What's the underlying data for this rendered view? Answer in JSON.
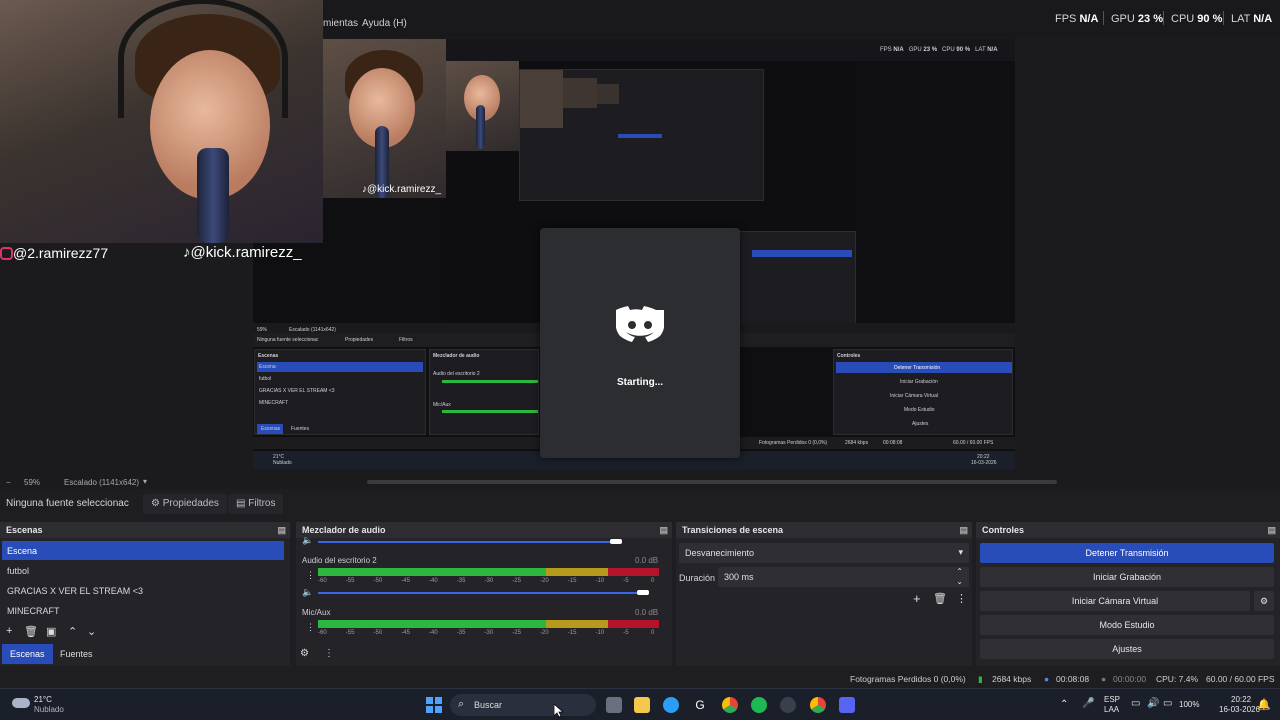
{
  "menu": {
    "items": [
      "mientas",
      "Ayuda (H)"
    ]
  },
  "stats": {
    "fps_label": "FPS",
    "fps_value": "N/A",
    "gpu_label": "GPU",
    "gpu_value": "23 %",
    "cpu_label": "CPU",
    "cpu_value": "90 %",
    "lat_label": "LAT",
    "lat_value": "N/A"
  },
  "overlay": {
    "instagram": "@2.ramirezz77",
    "tiktok": "@kick.ramirezz_",
    "tiktok_inner": "@kick.ramirezz_"
  },
  "discord": {
    "status": "Starting..."
  },
  "preview_footer": {
    "zoom": "59%",
    "scale": "Escalado (1141x642)"
  },
  "source_toolbar": {
    "no_source": "Ninguna fuente seleccionac",
    "properties": "Propiedades",
    "filters": "Filtros"
  },
  "scenes": {
    "title": "Escenas",
    "items": [
      "Escena",
      "futbol",
      "GRACIAS X VER EL STREAM <3",
      "MINECRAFT"
    ],
    "tabs": [
      "Escenas",
      "Fuentes"
    ]
  },
  "mixer": {
    "title": "Mezclador de audio",
    "channels": [
      {
        "name": "Audio del escritorio 2",
        "db": "0.0 dB",
        "level": 0.97
      },
      {
        "name": "Mic/Aux",
        "db": "0.0 dB",
        "level": 1.0
      }
    ],
    "ticks": [
      "-60",
      "-55",
      "-50",
      "-45",
      "-40",
      "-35",
      "-30",
      "-25",
      "-20",
      "-15",
      "-10",
      "-5",
      "0"
    ]
  },
  "transitions": {
    "title": "Transiciones de escena",
    "selected": "Desvanecimiento",
    "duration_label": "Duración",
    "duration_value": "300 ms"
  },
  "controls": {
    "title": "Controles",
    "stop_stream": "Detener Transmisión",
    "start_recording": "Iniciar Grabación",
    "start_virtual_cam": "Iniciar Cámara Virtual",
    "studio_mode": "Modo Estudio",
    "settings": "Ajustes"
  },
  "status_bar": {
    "dropped_frames": "Fotogramas Perdidos 0 (0,0%)",
    "bitrate": "2684 kbps",
    "stream_time": "00:08:08",
    "rec_time": "00:00:00",
    "cpu": "CPU: 7.4%",
    "fps": "60.00 / 60.00 FPS"
  },
  "taskbar": {
    "weather_temp": "21°C",
    "weather_desc": "Nublado",
    "search": "Buscar",
    "lang_top": "ESP",
    "lang_bottom": "LAA",
    "battery": "100%",
    "time": "20:22",
    "date": "16-03-2026"
  },
  "nested": {
    "no_source": "Ninguna fuente seleccionac",
    "properties": "Propiedades",
    "filters": "Filtros",
    "scenes_title": "Escenas",
    "scene_items": [
      "Escena",
      "futbol",
      "GRACIAS X VER EL STREAM <3",
      "MINECRAFT"
    ],
    "tabs": [
      "Escenas",
      "Fuentes"
    ],
    "mixer_title": "Mezclador de audio",
    "mixer_ch": "Audio del escritorio 2",
    "mixer_mic": "Mic/Aux",
    "controls_title": "Controles",
    "stop_stream": "Detener Transmisión",
    "start_recording": "Iniciar Grabación",
    "start_virtual_cam": "Iniciar Cámara Virtual",
    "studio_mode": "Modo Estudio",
    "settings": "Ajustes",
    "dropped": "Fotogramas Perdidos 0 (0,0%)",
    "bitrate": "2684 kbps",
    "stream_time": "00:08:08",
    "cpu": "CPU: 7.4%",
    "fps": "60.00 / 60.00 FPS",
    "temp": "21°C",
    "weather": "Nublado",
    "zoom": "59%",
    "scale": "Escalado (1141x642)",
    "time": "20:22",
    "date": "16-03-2026",
    "stats": {
      "fps": "N/A",
      "gpu": "23 %",
      "cpu": "90 %",
      "lat": "N/A"
    }
  },
  "colors": {
    "accent": "#284cb8",
    "meter_green": "#2db83d",
    "meter_yellow": "#b59a1b",
    "meter_red": "#b3142b",
    "discord": "#5865f2"
  }
}
